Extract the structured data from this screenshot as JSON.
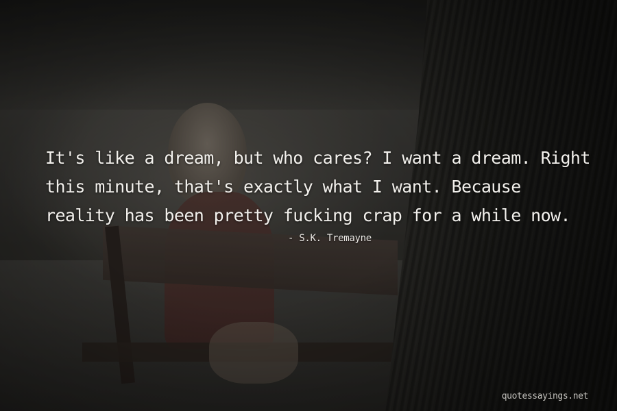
{
  "quote": {
    "text": "It's like a dream, but who cares? I want a dream. Right this minute, that's exactly what I want. Because reality has been pretty fucking crap for a while now.",
    "author": "- S.K. Tremayne"
  },
  "watermark": {
    "text": "quotessayings.net"
  }
}
